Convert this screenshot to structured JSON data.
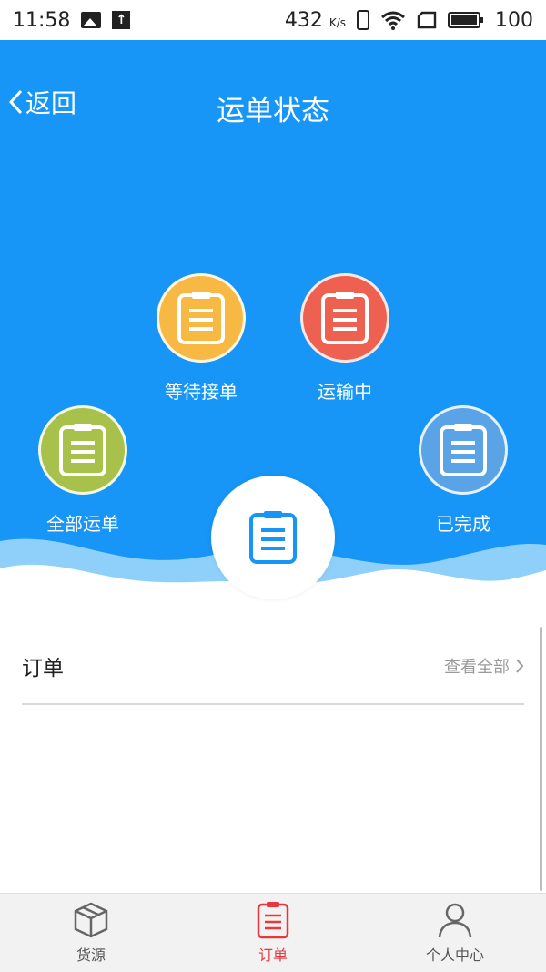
{
  "status_bar": {
    "time": "11:58",
    "network_speed": "432",
    "network_unit": "K/s",
    "battery": "100"
  },
  "header": {
    "back_label": "返回",
    "title": "运单状态"
  },
  "statuses": [
    {
      "label": "等待接单",
      "color": "#f7b944",
      "icon": "clipboard-icon"
    },
    {
      "label": "运输中",
      "color": "#ee6150",
      "icon": "clipboard-icon"
    },
    {
      "label": "全部运单",
      "color": "#a8c14b",
      "icon": "clipboard-icon"
    },
    {
      "label": "已完成",
      "color": "#5aa3e6",
      "icon": "clipboard-icon"
    }
  ],
  "orders": {
    "title": "订单",
    "view_all": "查看全部"
  },
  "bottom_nav": {
    "items": [
      {
        "label": "货源",
        "icon": "box-icon",
        "active": false
      },
      {
        "label": "订单",
        "icon": "clipboard-icon",
        "active": true
      },
      {
        "label": "个人中心",
        "icon": "person-icon",
        "active": false
      }
    ]
  },
  "colors": {
    "primary_blue": "#1796f7",
    "active_red": "#e8383d"
  }
}
